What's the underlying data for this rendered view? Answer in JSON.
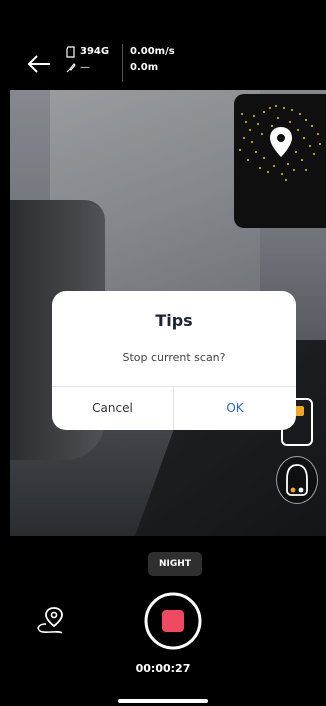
{
  "header": {
    "storage_value": "394G",
    "gps_value": "—",
    "speed": "0.00m/s",
    "distance": "0.0m"
  },
  "dialog": {
    "title": "Tips",
    "message": "Stop current scan?",
    "cancel_label": "Cancel",
    "ok_label": "OK"
  },
  "bottom": {
    "mode_label": "NIGHT",
    "timer": "00:00:27"
  },
  "icons": {
    "back": "back-arrow-icon",
    "storage": "sd-card-icon",
    "gps": "satellite-icon",
    "route": "route-pin-icon",
    "record": "record-stop-icon",
    "side_panel": "panel-toggle-icon",
    "robot": "robot-icon",
    "location": "location-pin-icon"
  },
  "colors": {
    "record_red": "#f0485f",
    "ok_blue": "#2a63c9",
    "pointcloud_yellow": "#e4c83a",
    "robot_orange": "#f2a623"
  }
}
